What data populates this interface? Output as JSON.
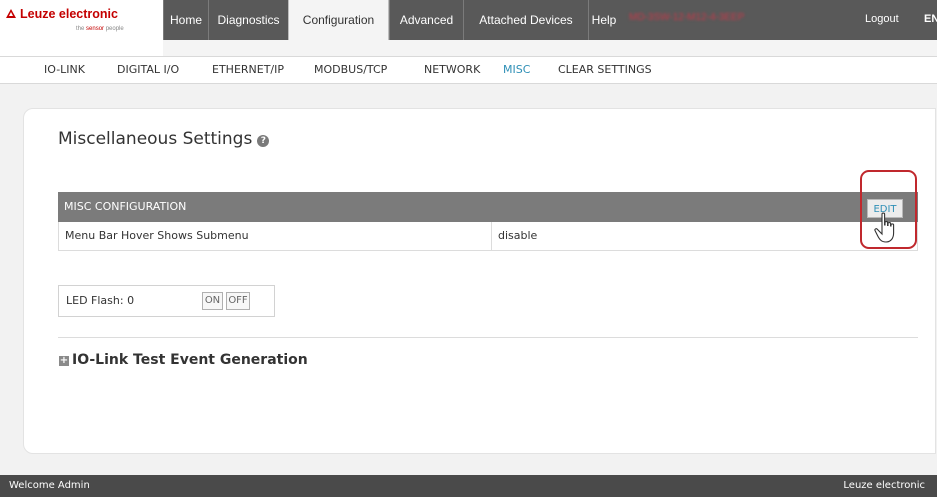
{
  "brand": {
    "name": "Leuze electronic",
    "tagline_prefix": "the ",
    "tagline_highlight": "sensor",
    "tagline_suffix": " people"
  },
  "nav": {
    "tabs": [
      "Home",
      "Diagnostics",
      "Configuration",
      "Advanced",
      "Attached Devices",
      "Help"
    ],
    "active": "Configuration",
    "device_id": "MD-3SW-12-M12-4-3EEP",
    "logout": "Logout",
    "language": "EN"
  },
  "subnav": {
    "items": [
      "IO-LINK",
      "DIGITAL I/O",
      "ETHERNET/IP",
      "MODBUS/TCP",
      "NETWORK",
      "MISC",
      "CLEAR SETTINGS"
    ],
    "active": "MISC"
  },
  "page": {
    "title": "Miscellaneous Settings",
    "help_icon": "?",
    "misc_table": {
      "header": "MISC CONFIGURATION",
      "edit_label": "EDIT",
      "rows": [
        {
          "label": "Menu Bar Hover Shows Submenu",
          "value": "disable"
        }
      ]
    },
    "led_flash": {
      "label": "LED Flash: 0",
      "on_label": "ON",
      "off_label": "OFF"
    },
    "test_event": {
      "expand_icon": "+",
      "label": "IO-Link Test Event Generation"
    }
  },
  "footer": {
    "welcome": "Welcome Admin",
    "brand": "Leuze electronic"
  },
  "colors": {
    "accent": "#2e8fb6",
    "brand_red": "#c40000",
    "highlight": "#c0282d",
    "nav_bg": "#595959"
  },
  "icons": {
    "help": "question-circle-icon",
    "expand": "plus-square-icon",
    "cursor": "hand-pointer-icon",
    "logo": "triangle-logo-icon"
  }
}
